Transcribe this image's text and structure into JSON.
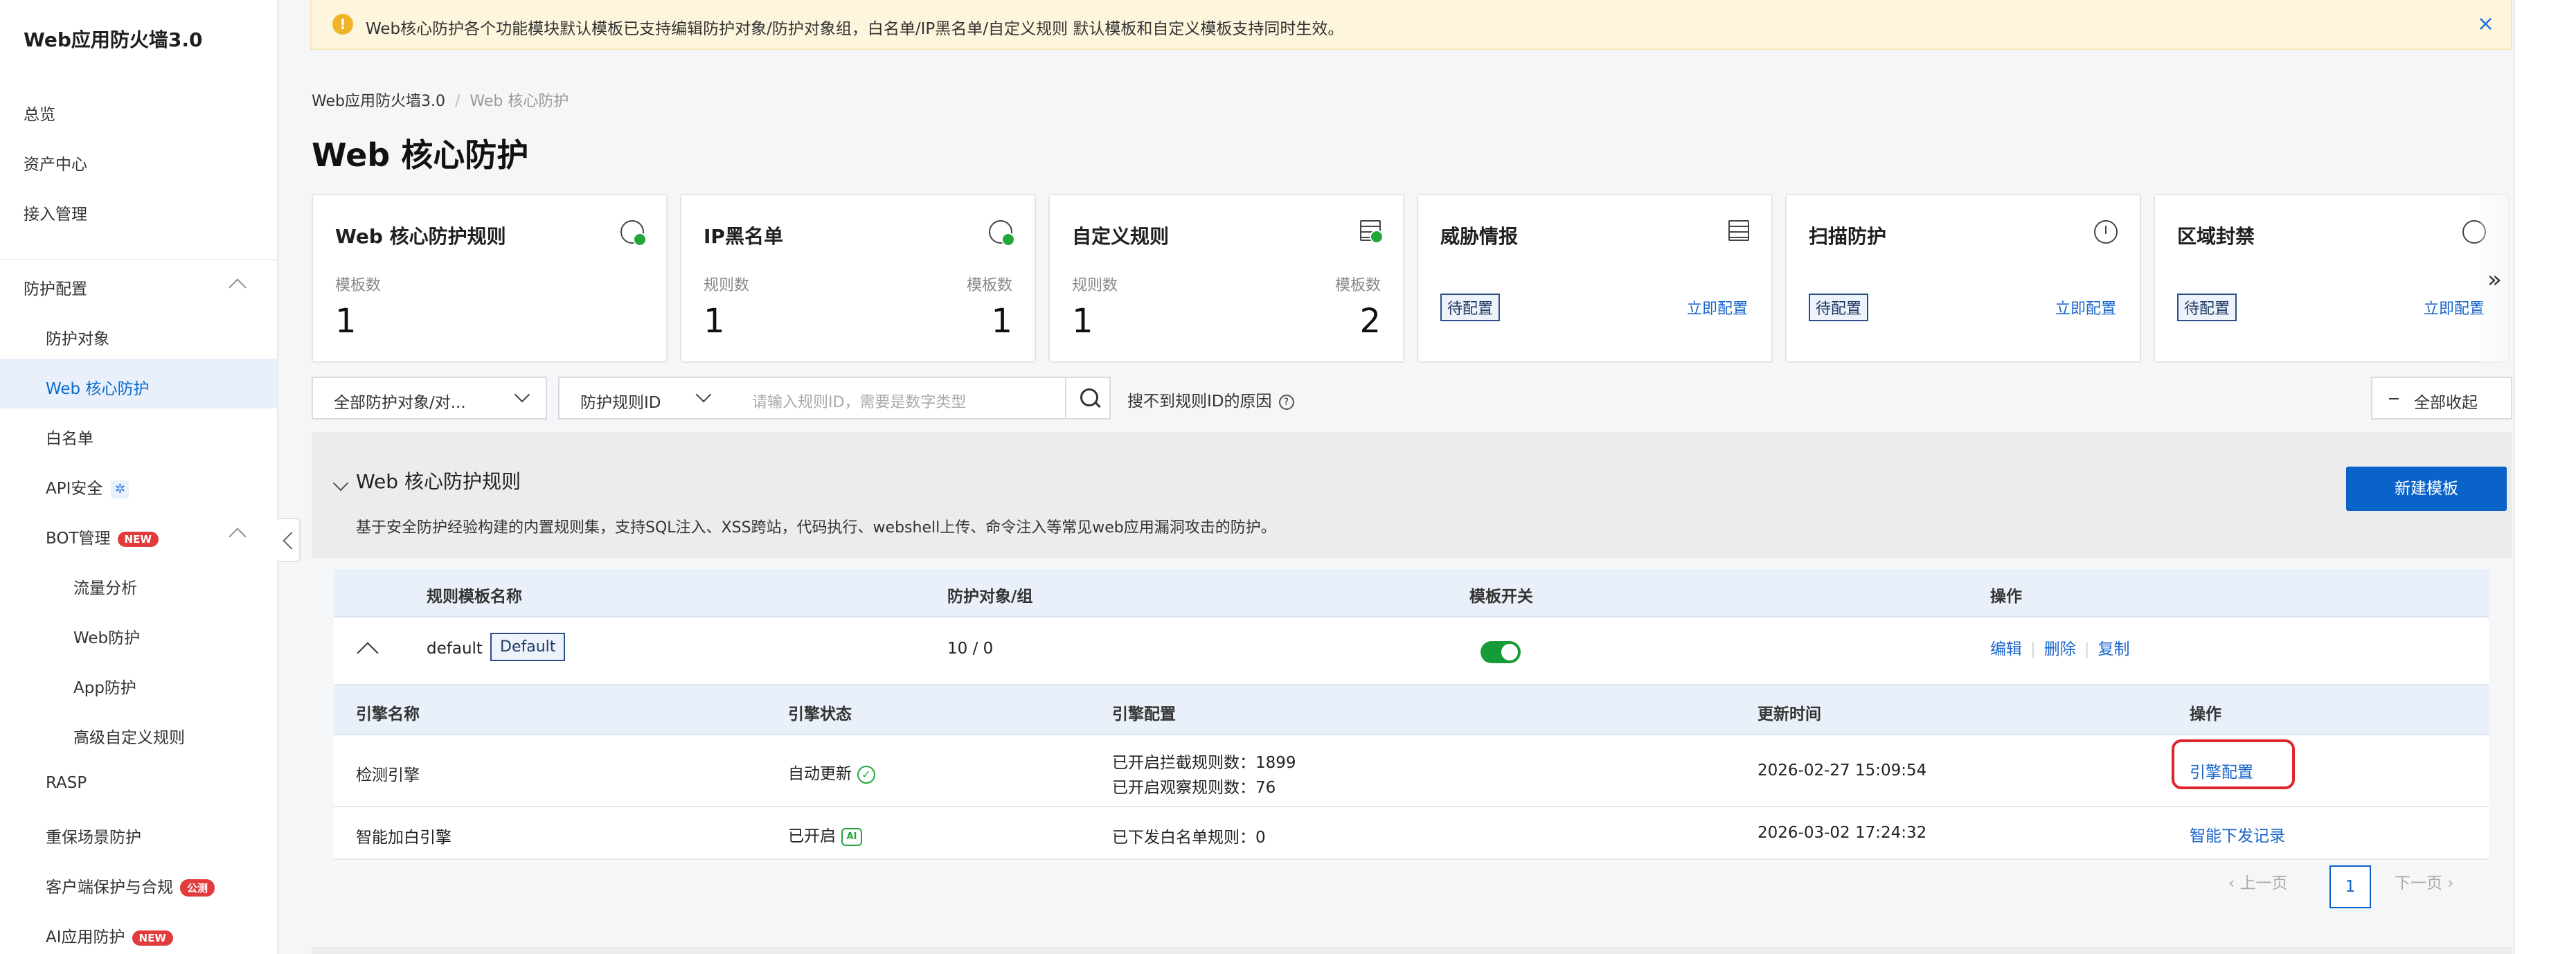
{
  "sidebar": {
    "brand": "Web应用防火墙3.0",
    "items": [
      {
        "label": "总览"
      },
      {
        "label": "资产中心"
      },
      {
        "label": "接入管理"
      },
      {
        "label": "防护配置"
      },
      {
        "label": "防护对象"
      },
      {
        "label": "Web 核心防护"
      },
      {
        "label": "白名单"
      },
      {
        "label": "API安全"
      },
      {
        "label": "BOT管理"
      },
      {
        "label": "流量分析"
      },
      {
        "label": "Web防护"
      },
      {
        "label": "App防护"
      },
      {
        "label": "高级自定义规则"
      },
      {
        "label": "RASP"
      },
      {
        "label": "重保场景防护"
      },
      {
        "label": "客户端保护与合规"
      },
      {
        "label": "AI应用防护"
      }
    ],
    "badge_new": "NEW",
    "badge_beta": "公测",
    "active_color": "#0a6ccf"
  },
  "notice": {
    "text": "Web核心防护各个功能模块默认模板已支持编辑防护对象/防护对象组，白名单/IP黑名单/自定义规则 默认模板和自定义模板支持同时生效。",
    "icon": "warning-icon",
    "close": "×"
  },
  "breadcrumb": {
    "root": "Web应用防火墙3.0",
    "sep": "/",
    "current": "Web 核心防护"
  },
  "page_title": "Web 核心防护",
  "cards": [
    {
      "title": "Web 核心防护规则",
      "label_left": "模板数",
      "num_left": "1"
    },
    {
      "title": "IP黑名单",
      "label_left": "规则数",
      "num_left": "1",
      "label_right": "模板数",
      "num_right": "1"
    },
    {
      "title": "自定义规则",
      "label_left": "规则数",
      "num_left": "1",
      "label_right": "模板数",
      "num_right": "2"
    },
    {
      "title": "威胁情报",
      "status": "待配置",
      "link": "立即配置"
    },
    {
      "title": "扫描防护",
      "status": "待配置",
      "link": "立即配置"
    },
    {
      "title": "区域封禁",
      "status": "待配置",
      "link": "立即配置"
    }
  ],
  "more": "»",
  "filters": {
    "object_select": "全部防护对象/对...",
    "field_select": "防护规则ID",
    "search_placeholder": "请输入规则ID，需要是数字类型",
    "why_link": "搜不到规则ID的原因",
    "why_q": "?",
    "collapse_all": "全部收起"
  },
  "group": {
    "title": "Web 核心防护规则",
    "desc": "基于安全防护经验构建的内置规则集，支持SQL注入、XSS跨站，代码执行、webshell上传、命令注入等常见web应用漏洞攻击的防护。",
    "new_button": "新建模板"
  },
  "table": {
    "headers": [
      "规则模板名称",
      "防护对象/组",
      "模板开关",
      "操作"
    ],
    "row": {
      "name": "default",
      "tag": "Default",
      "objects": "10 / 0",
      "switch_on": true,
      "actions": [
        "编辑",
        "删除",
        "复制"
      ]
    },
    "engine_headers": [
      "引擎名称",
      "引擎状态",
      "引擎配置",
      "更新时间",
      "操作"
    ],
    "engines": [
      {
        "name": "检测引擎",
        "status": "自动更新",
        "config_lines": [
          "已开启拦截规则数：1899",
          "已开启观察规则数：76"
        ],
        "updated": "2026-02-27 15:09:54",
        "action": "引擎配置"
      },
      {
        "name": "智能加白引擎",
        "status": "已开启",
        "config_lines": [
          "已下发白名单规则：0"
        ],
        "updated": "2026-03-02 17:24:32",
        "action": "智能下发记录"
      }
    ]
  },
  "pagination": {
    "prev": "上一页",
    "current": "1",
    "next": "下一页"
  }
}
